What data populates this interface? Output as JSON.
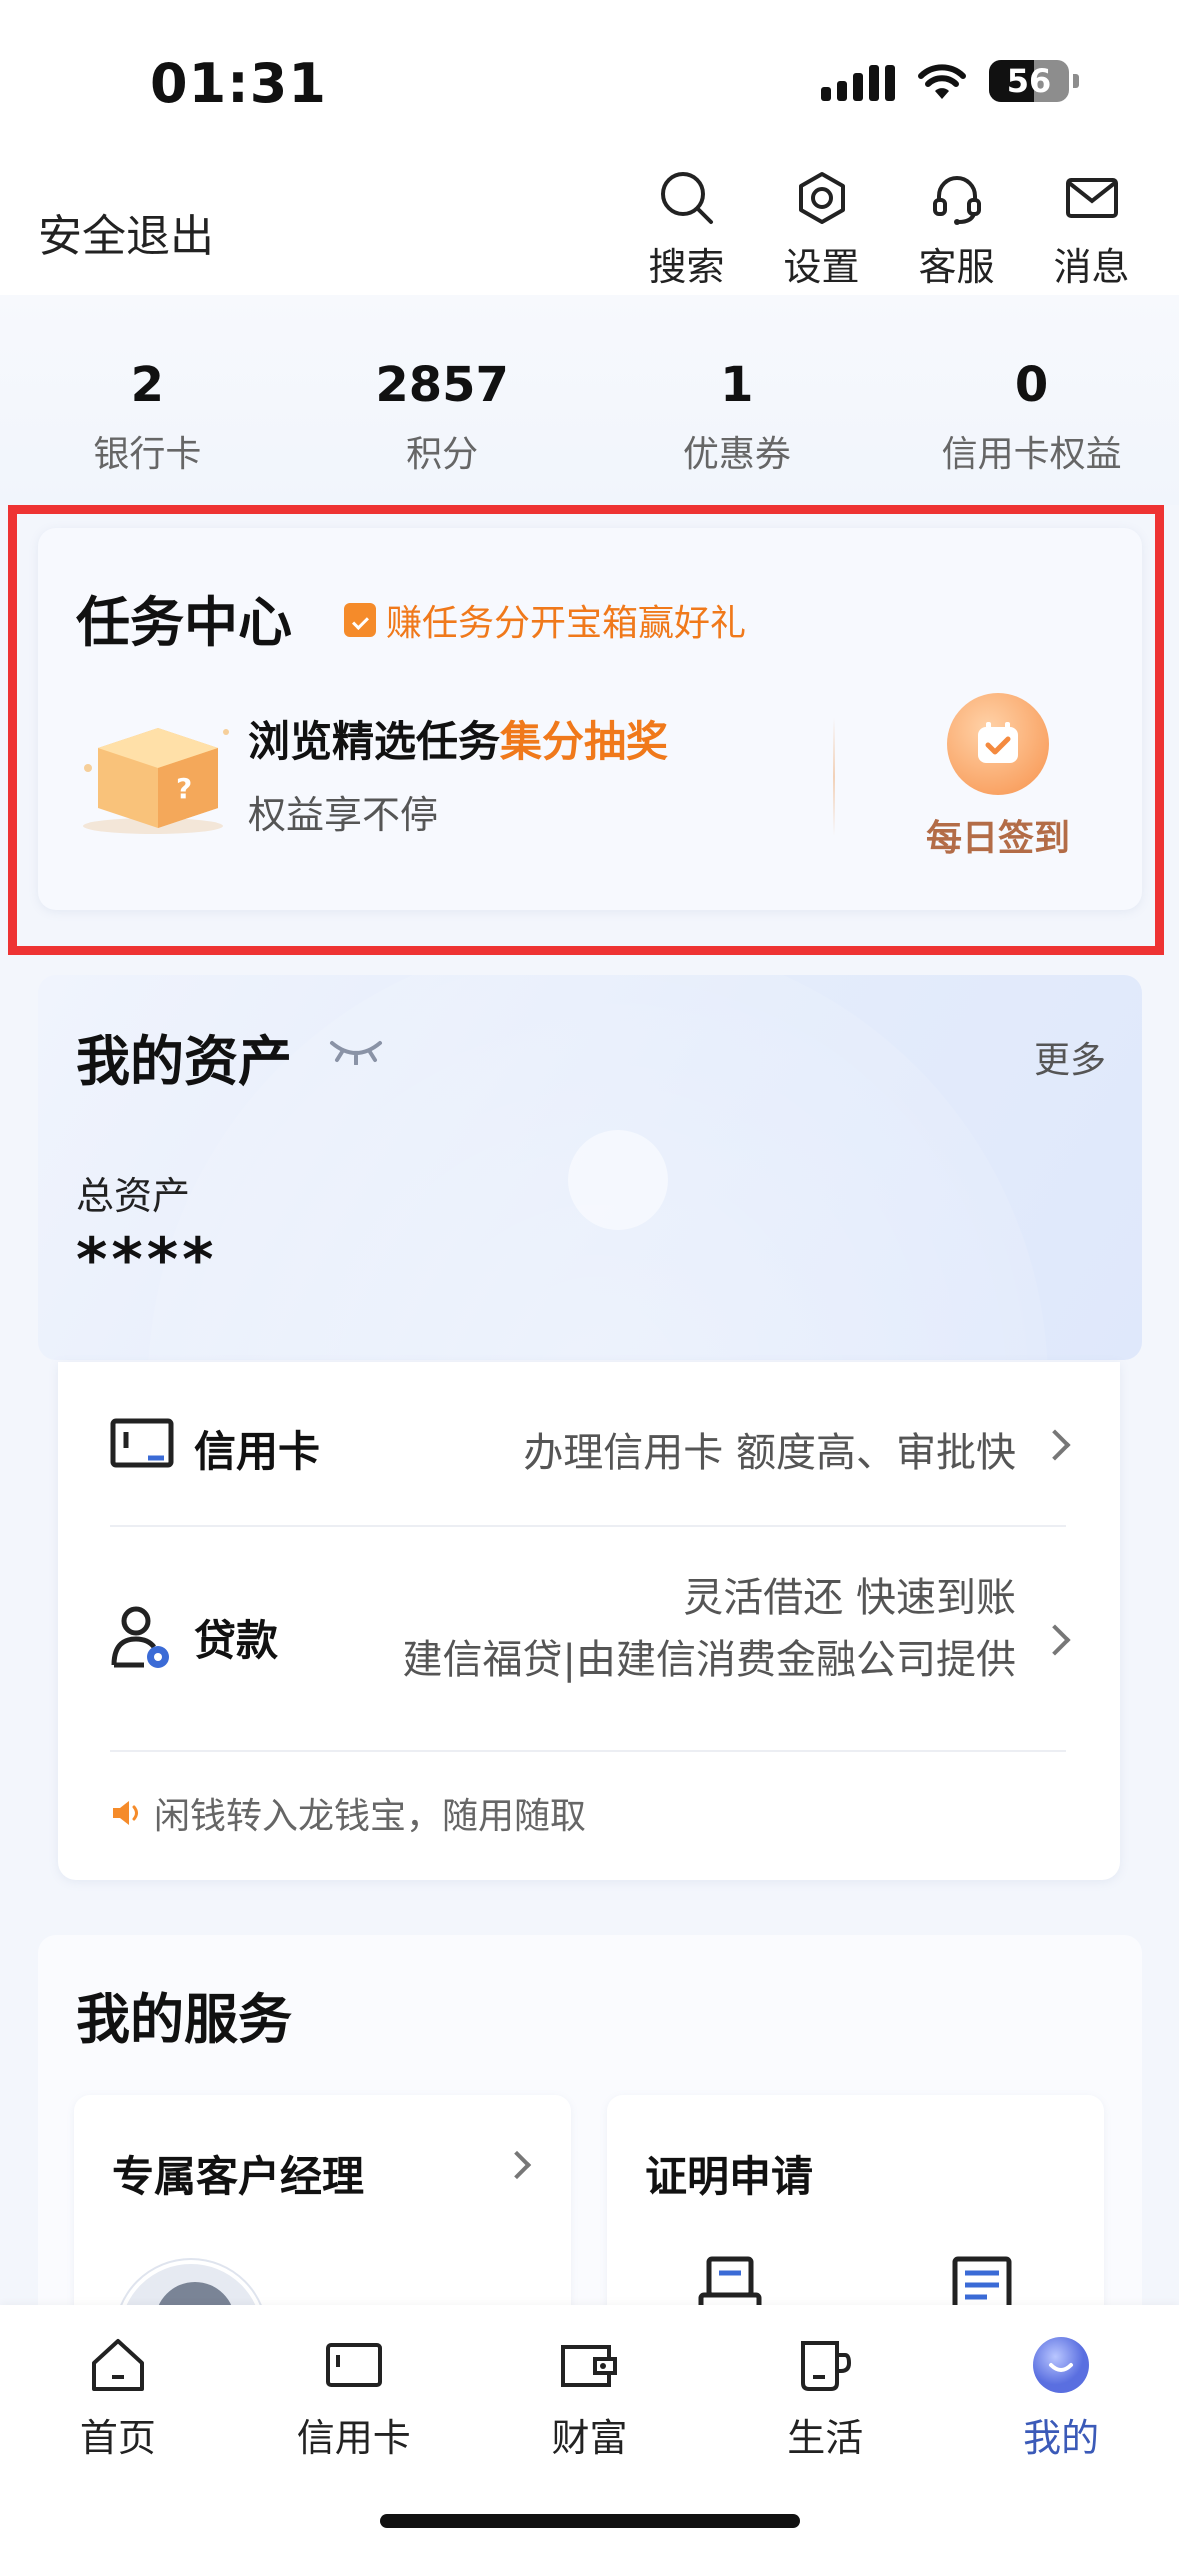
{
  "status": {
    "time": "01:31",
    "battery": "56",
    "battery_level": 0.56
  },
  "topnav": {
    "logout": "安全退出",
    "actions": [
      {
        "label": "搜索",
        "icon": "search-icon"
      },
      {
        "label": "设置",
        "icon": "gear-icon"
      },
      {
        "label": "客服",
        "icon": "headset-icon"
      },
      {
        "label": "消息",
        "icon": "mail-icon"
      }
    ]
  },
  "stats": [
    {
      "value": "2",
      "label": "银行卡"
    },
    {
      "value": "2857",
      "label": "积分"
    },
    {
      "value": "1",
      "label": "优惠券"
    },
    {
      "value": "0",
      "label": "信用卡权益"
    }
  ],
  "task_center": {
    "title": "任务中心",
    "promo": "赚任务分开宝箱赢好礼",
    "line1_prefix": "浏览精选任务",
    "line1_accent": "集分抽奖",
    "line2": "权益享不停",
    "checkin_label": "每日签到"
  },
  "assets": {
    "title": "我的资产",
    "more": "更多",
    "total_label": "总资产",
    "total_value": "****"
  },
  "products": {
    "credit_card": {
      "name": "信用卡",
      "desc": "办理信用卡 额度高、审批快"
    },
    "loan": {
      "name": "贷款",
      "desc_line1": "灵活借还 快速到账",
      "desc_line2": "建信福贷|由建信消费金融公司提供"
    },
    "notice": "闲钱转入龙钱宝，随用随取"
  },
  "services": {
    "title": "我的服务",
    "tiles": [
      {
        "title": "专属客户经理"
      },
      {
        "title": "证明申请"
      }
    ]
  },
  "tabbar": [
    {
      "label": "首页",
      "icon": "home-icon"
    },
    {
      "label": "信用卡",
      "icon": "card-icon"
    },
    {
      "label": "财富",
      "icon": "wallet-icon"
    },
    {
      "label": "生活",
      "icon": "cup-icon"
    },
    {
      "label": "我的",
      "icon": "profile-icon",
      "active": true
    }
  ],
  "colors": {
    "accent_orange": "#f0791b",
    "active_blue": "#3b5ab8",
    "highlight_red": "#ee3333"
  }
}
